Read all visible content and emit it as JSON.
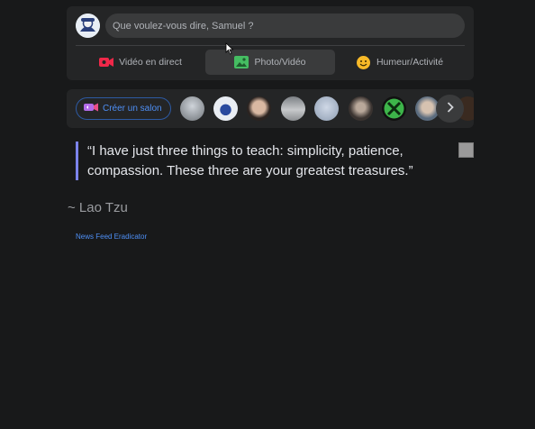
{
  "composer": {
    "placeholder": "Que voulez-vous dire, Samuel ?",
    "actions": [
      {
        "label": "Vidéo en direct",
        "icon": "live-video-icon",
        "color": "#f02849"
      },
      {
        "label": "Photo/Vidéo",
        "icon": "photo-icon",
        "color": "#45bd62"
      },
      {
        "label": "Humeur/Activité",
        "icon": "feeling-icon",
        "color": "#f7b928"
      }
    ]
  },
  "rooms": {
    "create_label": "Créer un salon",
    "create_icon": "room-icon",
    "next_icon": "chevron-right-icon"
  },
  "quote": {
    "text": "“I have just three things to teach: simplicity, patience, compassion. These three are your greatest treasures.”",
    "author": "~ Lao Tzu"
  },
  "footer": {
    "link": "News Feed Eradicator"
  },
  "colors": {
    "background": "#18191a",
    "card": "#242526",
    "accent_blue": "#4e8ff5",
    "quote_bar": "#7b83eb"
  }
}
